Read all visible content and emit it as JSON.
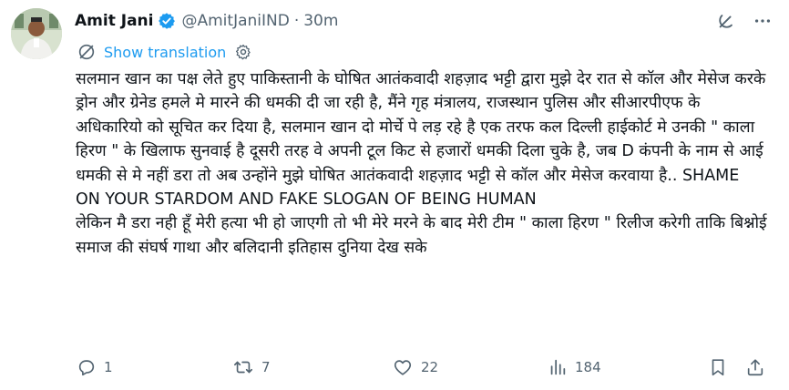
{
  "author": {
    "name": "Amit Jani",
    "handle": "@AmitJaniIND",
    "separator": "·",
    "time": "30m",
    "verified": true
  },
  "translate": {
    "label": "Show translation"
  },
  "tweet": {
    "paragraphs": [
      "सलमान खान का पक्ष लेते हुए पाकिस्तानी के घोषित आतंकवादी शहज़ाद भट्टी द्वारा मुझे देर रात से कॉल और मेसेज करके ड्रोन और ग्रेनेड हमले मे मारने की धमकी दी जा रही है, मैंने गृह मंत्रालय, राजस्थान पुलिस और सीआरपीएफ के अधिकारियो को सूचित कर दिया है, सलमान खान दो मोर्चे पे लड़ रहे है एक तरफ कल दिल्ली हाईकोर्ट मे उनकी \" काला हिरण \" के खिलाफ सुनवाई है दूसरी तरह वे अपनी टूल किट से हजारों धमकी दिला चुके है, जब D कंपनी के नाम से आई धमकी से मे नहीं डरा तो अब उन्होंने मुझे घोषित आतंकवादी शहज़ाद भट्टी से कॉल और मेसेज करवाया है.. SHAME ON YOUR STARDOM AND FAKE SLOGAN OF BEING HUMAN",
      "लेकिन मै डरा नही हूँ मेरी हत्या भी हो जाएगी तो भी मेरे मरने के बाद मेरी टीम \" काला हिरण \" रिलीज करेगी ताकि बिश्नोई समाज की संघर्ष गाथा और बलिदानी इतिहास दुनिया देख सके"
    ]
  },
  "actions": {
    "replies": "1",
    "retweets": "7",
    "likes": "22",
    "views": "184"
  },
  "icons": {
    "verified": "verified-badge-icon",
    "grok": "grok-icon",
    "more": "more-icon",
    "translate": "translate-icon",
    "settings": "gear-icon",
    "reply": "reply-icon",
    "retweet": "retweet-icon",
    "like": "heart-icon",
    "views": "views-icon",
    "bookmark": "bookmark-icon",
    "share": "share-icon"
  },
  "colors": {
    "text": "#0f1419",
    "secondary": "#536471",
    "accent": "#1d9bf0"
  }
}
